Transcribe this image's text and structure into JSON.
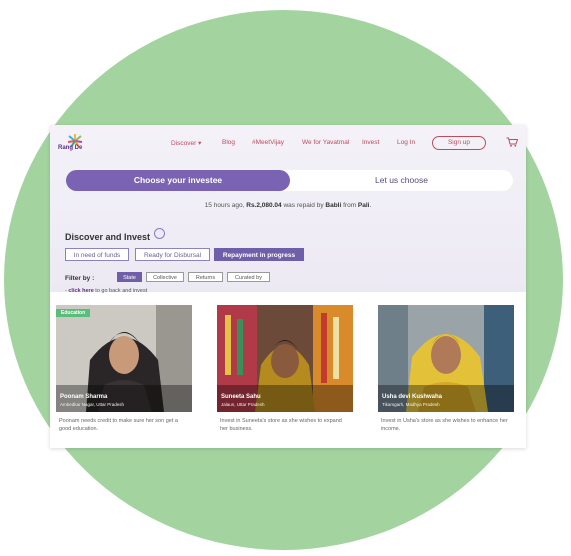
{
  "brand": {
    "logo_text": "Rang De"
  },
  "nav": {
    "discover": "Discover",
    "blog": "Blog",
    "meetvijay": "#MeetVijay",
    "we_for_yavatmal": "We for Yavatmal",
    "invest": "Invest",
    "login": "Log In",
    "signup": "Sign up"
  },
  "toggle": {
    "choose": "Choose your investee",
    "let_us": "Let us choose"
  },
  "repaid": {
    "pre": "15 hours ago, ",
    "amount": "Rs.2,080.04",
    "mid": " was repaid by ",
    "name": "Babli",
    "from": " from ",
    "place": "Pali",
    "end": "."
  },
  "section": {
    "title": "Discover and Invest"
  },
  "tabs": [
    "In need of funds",
    "Ready for Disbursal",
    "Repayment in progress"
  ],
  "filter": {
    "label": "Filter by :",
    "options": [
      "State",
      "Collective",
      "Returns",
      "Curated by"
    ]
  },
  "back": {
    "link": "click here",
    "text": " to go back and invest"
  },
  "cards": [
    {
      "badge": "Education",
      "name": "Poonam Sharma",
      "place": "Ambedkar Nagar, Uttar Pradesh",
      "desc": "Poonam needs credit to make sure her son get a good education."
    },
    {
      "name": "Suneeta Sahu",
      "place": "Jalaun, Uttar Pradesh",
      "desc": "Invest in Suneeta's store as she wishes to expand her business."
    },
    {
      "name": "Usha devi Kushwaha",
      "place": "Tikamgarh, Madhya Pradesh",
      "desc": "Invest in Usha's store as she wishes to enhance her income."
    }
  ],
  "colors": {
    "accent": "#6f5ea8",
    "brand": "#c04b5c",
    "background_circle": "#a3d4a0",
    "badge": "#5bbd7a"
  }
}
